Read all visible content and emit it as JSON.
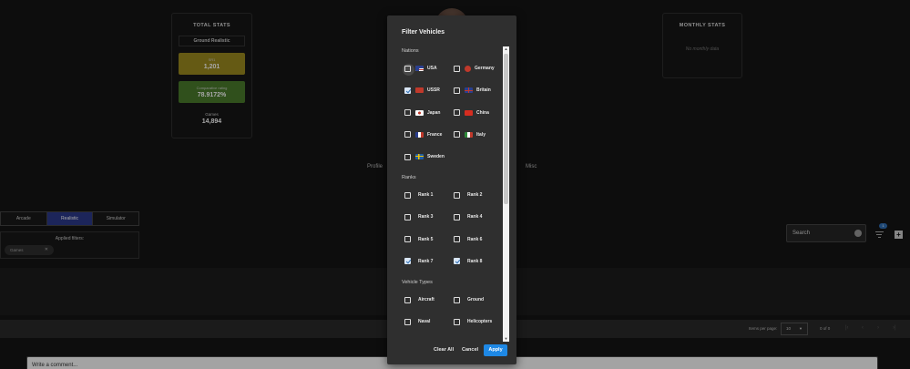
{
  "total_stats": {
    "title": "TOTAL STATS",
    "mode": "Ground Realistic",
    "sr_label": "SR1",
    "sr_value": "1,201",
    "rating_label": "Comparative rating",
    "rating_value": "78.9172%",
    "games_label": "Games",
    "games_value": "14,894"
  },
  "monthly_stats": {
    "title": "MONTHLY STATS",
    "empty": "No monthly data"
  },
  "nav": {
    "profile": "Profile",
    "misc": "Misc"
  },
  "mode_tabs": [
    "Arcade",
    "Realistic",
    "Simulator"
  ],
  "applied": {
    "title": "Applied filters:",
    "chip": "Games"
  },
  "search": {
    "placeholder": "Search",
    "badge": "1"
  },
  "pagination": {
    "items_per_page_label": "Items per page:",
    "items_per_page": "10",
    "range": "0 of 0"
  },
  "comment": {
    "placeholder": "Write a comment..."
  },
  "modal": {
    "title": "Filter Vehicles",
    "sections": {
      "nations": "Nations",
      "ranks": "Ranks",
      "types": "Vehicle Types"
    },
    "nations": [
      {
        "label": "USA",
        "checked": false
      },
      {
        "label": "Germany",
        "checked": false
      },
      {
        "label": "USSR",
        "checked": true
      },
      {
        "label": "Britain",
        "checked": false
      },
      {
        "label": "Japan",
        "checked": false
      },
      {
        "label": "China",
        "checked": false
      },
      {
        "label": "France",
        "checked": false
      },
      {
        "label": "Italy",
        "checked": false
      },
      {
        "label": "Sweden",
        "checked": false
      }
    ],
    "ranks": [
      {
        "label": "Rank 1",
        "checked": false
      },
      {
        "label": "Rank 2",
        "checked": false
      },
      {
        "label": "Rank 3",
        "checked": false
      },
      {
        "label": "Rank 4",
        "checked": false
      },
      {
        "label": "Rank 5",
        "checked": false
      },
      {
        "label": "Rank 6",
        "checked": false
      },
      {
        "label": "Rank 7",
        "checked": true
      },
      {
        "label": "Rank 8",
        "checked": true
      }
    ],
    "types": [
      {
        "label": "Aircraft",
        "checked": false
      },
      {
        "label": "Ground",
        "checked": false
      },
      {
        "label": "Naval",
        "checked": false
      },
      {
        "label": "Helicopters",
        "checked": false
      }
    ],
    "buttons": {
      "clear": "Clear All",
      "cancel": "Cancel",
      "apply": "Apply"
    }
  },
  "colors": {
    "accent": "#1e88e5",
    "active_tab": "#2c3a8a",
    "sr_tile": "#9c8a1f",
    "rating_tile": "#4a7b2b"
  }
}
